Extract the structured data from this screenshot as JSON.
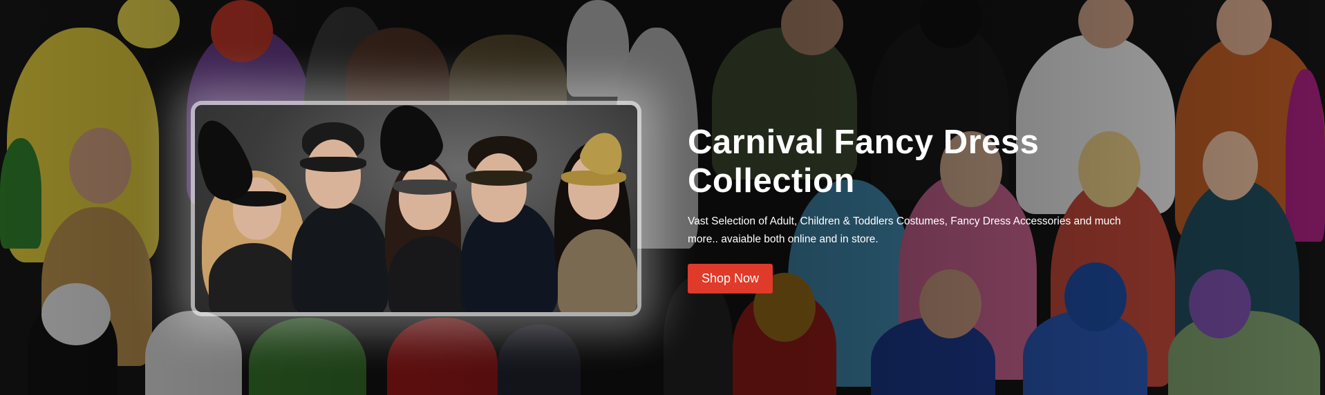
{
  "banner": {
    "title_line1": "Carnival Fancy Dress",
    "title_line2": "Collection",
    "description": "Vast Selection of Adult, Children & Toddlers Costumes, Fancy Dress Accessories and much more.. avaiable both online and in store.",
    "button_label": "Shop Now",
    "image_subject": "masquerade-masks-group-photo",
    "background_subject": "costumed-crowd-background"
  },
  "colors": {
    "button_bg": "#e03a2a",
    "title_text": "#ffffff",
    "overlay": "#000000"
  }
}
